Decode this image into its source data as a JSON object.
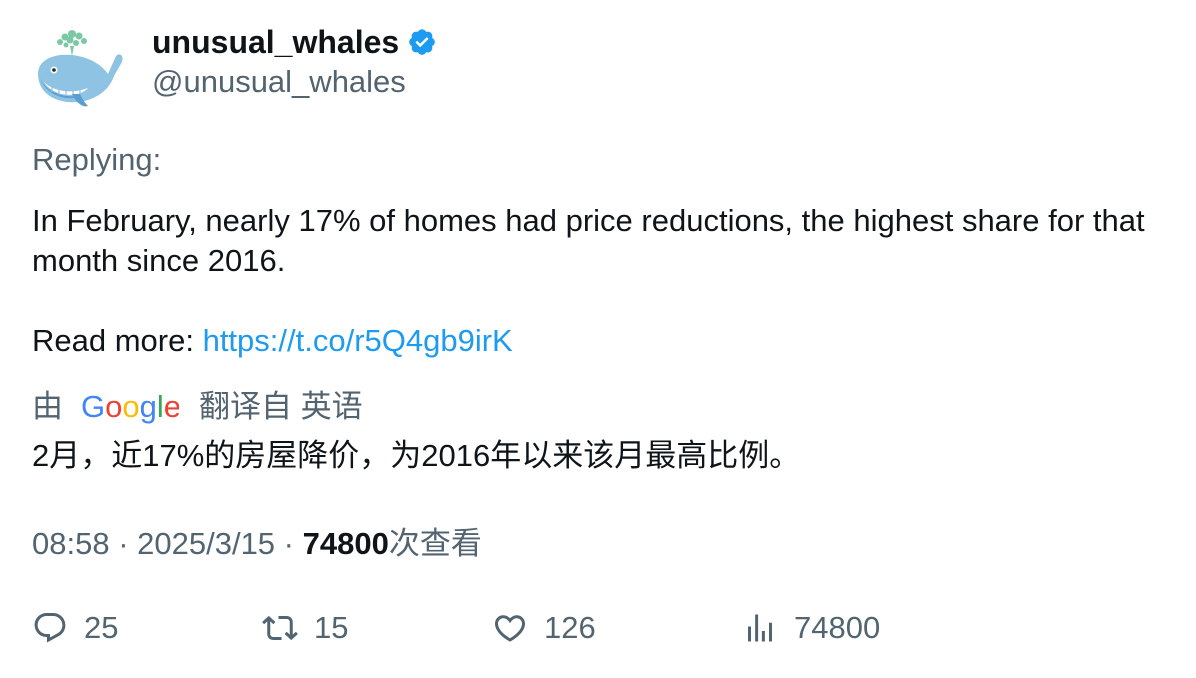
{
  "author": {
    "display_name": "unusual_whales",
    "handle": "@unusual_whales",
    "verified_color": "#1d9bf0",
    "avatar_icon": "whale-icon"
  },
  "reply_context": "Replying:",
  "tweet": {
    "line1": "In February, nearly 17% of homes had price reductions, the highest share for that month since 2016.",
    "read_more_prefix": "Read more: ",
    "link_text": "https://t.co/r5Q4gb9irK"
  },
  "translation": {
    "by_label": "由",
    "provider": "Google",
    "from_label": "翻译自 英语",
    "text": "2月，近17%的房屋降价，为2016年以来该月最高比例。"
  },
  "meta": {
    "time": "08:58",
    "sep1": " · ",
    "date": "2025/3/15",
    "sep2": " · ",
    "views": "74800",
    "views_label": "次查看"
  },
  "actions": {
    "replies": "25",
    "retweets": "15",
    "likes": "126",
    "views": "74800"
  },
  "colors": {
    "text": "#0f1419",
    "secondary": "#536471",
    "link": "#1d9bf0"
  }
}
